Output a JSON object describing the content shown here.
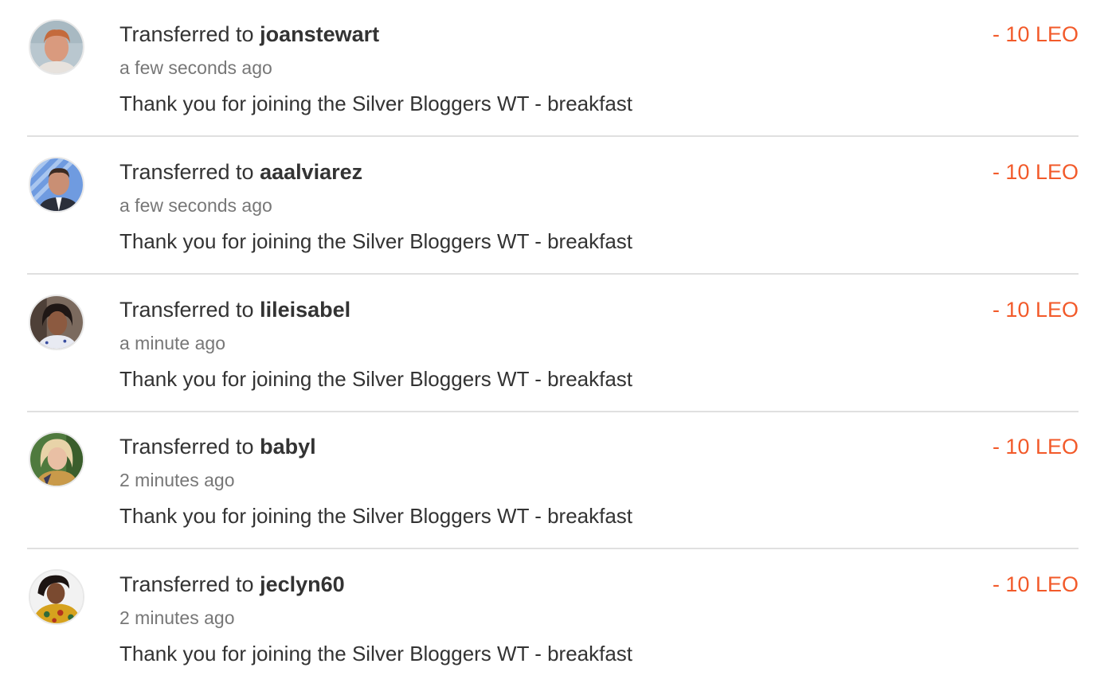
{
  "accent_color": "#f25a2a",
  "transfers": [
    {
      "prefix": "Transferred to ",
      "username": "joanstewart",
      "time": "a few seconds ago",
      "memo": "Thank you for joining the Silver Bloggers WT - breakfast",
      "amount": "- 10 LEO",
      "avatar_icon": "user-avatar-photo"
    },
    {
      "prefix": "Transferred to ",
      "username": "aaalviarez",
      "time": "a few seconds ago",
      "memo": "Thank you for joining the Silver Bloggers WT - breakfast",
      "amount": "- 10 LEO",
      "avatar_icon": "user-avatar-photo"
    },
    {
      "prefix": "Transferred to ",
      "username": "lileisabel",
      "time": "a minute ago",
      "memo": "Thank you for joining the Silver Bloggers WT - breakfast",
      "amount": "- 10 LEO",
      "avatar_icon": "user-avatar-photo"
    },
    {
      "prefix": "Transferred to ",
      "username": "babyl",
      "time": "2 minutes ago",
      "memo": "Thank you for joining the Silver Bloggers WT - breakfast",
      "amount": "- 10 LEO",
      "avatar_icon": "user-avatar-photo"
    },
    {
      "prefix": "Transferred to ",
      "username": "jeclyn60",
      "time": "2 minutes ago",
      "memo": "Thank you for joining the Silver Bloggers WT - breakfast",
      "amount": "- 10 LEO",
      "avatar_icon": "user-avatar-photo"
    }
  ]
}
